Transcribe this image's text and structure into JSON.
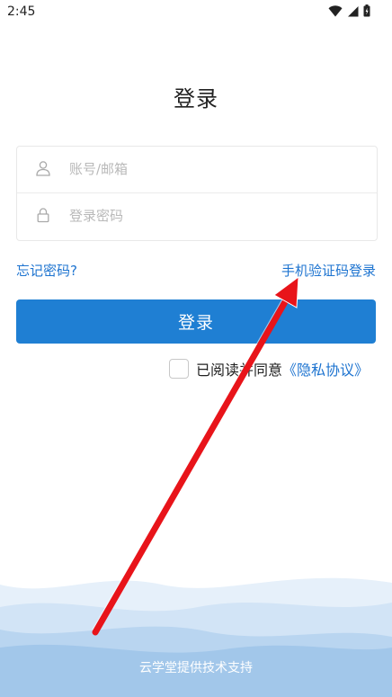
{
  "status_bar": {
    "time": "2:45"
  },
  "page": {
    "title": "登录"
  },
  "form": {
    "username_placeholder": "账号/邮箱",
    "password_placeholder": "登录密码"
  },
  "links": {
    "forgot_password": "忘记密码?",
    "sms_login": "手机验证码登录"
  },
  "login_button": "登录",
  "agreement": {
    "prefix": "已阅读并同意",
    "privacy_link": "《隐私协议》",
    "checked": false
  },
  "footer": "云学堂提供技术支持",
  "colors": {
    "accent": "#1f7fd3",
    "link": "#1e74d0",
    "annotation_arrow": "#e8141a"
  },
  "icons": [
    "wifi-icon",
    "signal-icon",
    "battery-icon",
    "user-icon",
    "lock-icon"
  ]
}
